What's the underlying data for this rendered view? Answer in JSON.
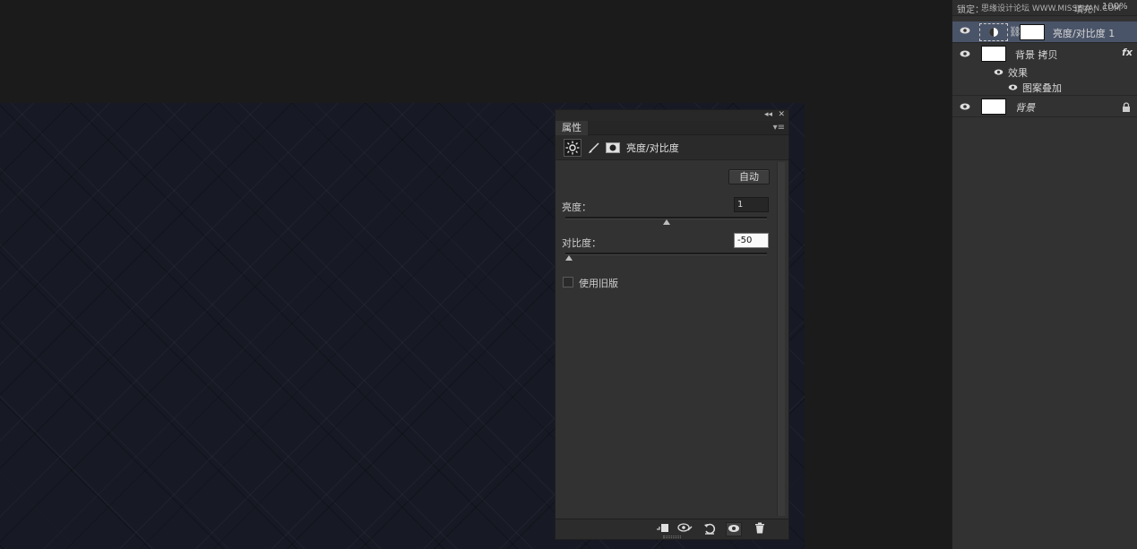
{
  "properties_panel": {
    "tab_label": "属性",
    "collapse_glyph": "◂◂",
    "close_glyph": "✕",
    "menu_glyph": "▾≡",
    "adjustment_title": "亮度/对比度",
    "auto_button": "自动",
    "brightness": {
      "label": "亮度：",
      "value": "1",
      "slider_fraction": 0.5
    },
    "contrast": {
      "label": "对比度：",
      "value": "-50",
      "slider_fraction": 0.0
    },
    "legacy_checkbox": {
      "label": "使用旧版",
      "checked": false
    },
    "header_icons": [
      "sun-icon",
      "brush-icon",
      "mask-icon"
    ],
    "footer_icons": [
      "clip-to-layer-icon",
      "view-previous-icon",
      "reset-icon",
      "visibility-icon",
      "trash-icon"
    ]
  },
  "layers_panel": {
    "lock_label": "锁定：",
    "fill_label": "填充：",
    "fill_value": "100%",
    "watermark": "思缘设计论坛  WWW.MISSYUAN.COM",
    "layers": [
      {
        "name": "亮度/对比度 1",
        "type": "adjustment",
        "selected": true,
        "visible": true
      },
      {
        "name": "背景 拷贝",
        "type": "pixel",
        "selected": false,
        "visible": true,
        "fx": "fx",
        "effects_label": "效果",
        "effects": [
          "图案叠加"
        ]
      },
      {
        "name": "背景",
        "type": "background",
        "selected": false,
        "visible": true,
        "locked": true
      }
    ]
  },
  "colors": {
    "workspace": "#1b1b1b",
    "canvas": "#171a24",
    "panel": "#323232",
    "selected_layer": "#4a5468"
  }
}
